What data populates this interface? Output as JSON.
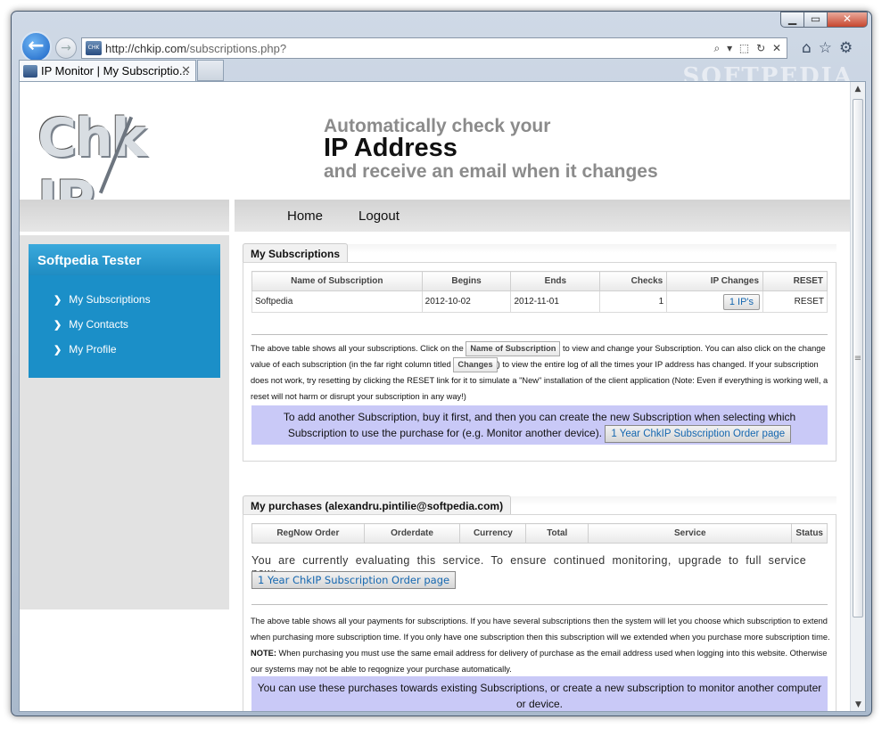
{
  "browser": {
    "url_host": "http://chkip.com",
    "url_path": "/subscriptions.php?",
    "address_controls": "⌕ ▾ ⬚ ↻ ✕",
    "tab_title": "IP Monitor | My Subscriptio...",
    "watermark": "SOFTPEDIA"
  },
  "header": {
    "logo_text": "Chk  IP",
    "tagline_1": "Automatically check your",
    "tagline_2": "IP Address",
    "tagline_3": "and receive an email when it changes"
  },
  "topnav": {
    "home": "Home",
    "logout": "Logout"
  },
  "sidebar": {
    "title": "Softpedia Tester",
    "items": [
      {
        "label": "My Subscriptions"
      },
      {
        "label": "My Contacts"
      },
      {
        "label": "My Profile"
      }
    ]
  },
  "subscriptions": {
    "tab_label": "My Subscriptions",
    "columns": [
      "Name of Subscription",
      "Begins",
      "Ends",
      "Checks",
      "IP Changes",
      "RESET"
    ],
    "rows": [
      {
        "name": "Softpedia",
        "begins": "2012-10-02",
        "ends": "2012-11-01",
        "checks": "1",
        "ip_changes": "1 IP's",
        "reset": "RESET"
      }
    ],
    "para_1a": "The above table shows all your subscriptions. Click on the",
    "chip_name": "Name of Subscription",
    "para_1b": "to view and change your Subscription. You can also click on the change value of each subscription (in the far right column titled",
    "chip_changes": "Changes",
    "para_1c": ") to view the entire log of all the times your IP address has changed. If your subscription does not work, try resetting by clicking the RESET link for it to simulate a \"New\" installation of the client application (Note: Even if everything is working well, a reset will not harm or disrupt your subscription in any way!)",
    "notice": "To add another Subscription, buy it first, and then you can create the new Subscription when selecting which Subscription to use the purchase for (e.g. Monitor another device).",
    "order_button": "1 Year ChkIP Subscription Order page"
  },
  "purchases": {
    "tab_label": "My purchases (alexandru.pintilie@softpedia.com)",
    "columns": [
      "RegNow Order",
      "Orderdate",
      "Currency",
      "Total",
      "Service",
      "Status"
    ],
    "eval_text": "You are currently evaluating this service. To ensure continued monitoring, upgrade to full service now:",
    "order_button": "1 Year ChkIP Subscription Order page",
    "para_a": "The above table shows all your payments for subscriptions. If you have several subscriptions then the system will let you choose which subscription to extend when purchasing more subscription time. If you only have one subscription then this subscription will we extended when you purchase more subscription time.",
    "para_note": "NOTE:",
    "para_b": "When purchasing you must use the same email address for delivery of purchase as the email address used when logging into this website. Otherwise our systems may not be able to reqognize your purchase automatically.",
    "notice": "You can use these purchases towards existing Subscriptions, or create a new subscription to monitor another computer or device."
  }
}
